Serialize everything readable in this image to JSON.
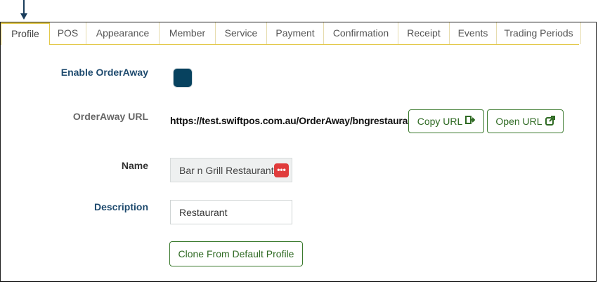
{
  "tabs": [
    {
      "label": "Profile",
      "active": true
    },
    {
      "label": "POS"
    },
    {
      "label": "Appearance"
    },
    {
      "label": "Member"
    },
    {
      "label": "Service"
    },
    {
      "label": "Payment"
    },
    {
      "label": "Confirmation"
    },
    {
      "label": "Receipt"
    },
    {
      "label": "Events"
    },
    {
      "label": "Trading Periods"
    }
  ],
  "form": {
    "enable_label": "Enable OrderAway",
    "enable_checked": true,
    "url_label": "OrderAway URL",
    "url_value": "https://test.swiftpos.com.au/OrderAway/bngrestaurant",
    "copy_url": "Copy URL",
    "open_url": "Open URL",
    "name_label": "Name",
    "name_value": "Bar n Grill Restaurant",
    "description_label": "Description",
    "description_value": "Restaurant",
    "clone_button": "Clone From Default Profile"
  },
  "colors": {
    "accent_gold": "#e3c94a",
    "label_blue": "#1e4a6e",
    "button_green": "#2f6a23",
    "checkbox_fill": "#07425f",
    "dots_red": "#e03c3c"
  },
  "icons": {
    "copy": "copy-url-icon",
    "open": "external-link-icon",
    "name_action": "more-dots-icon"
  }
}
